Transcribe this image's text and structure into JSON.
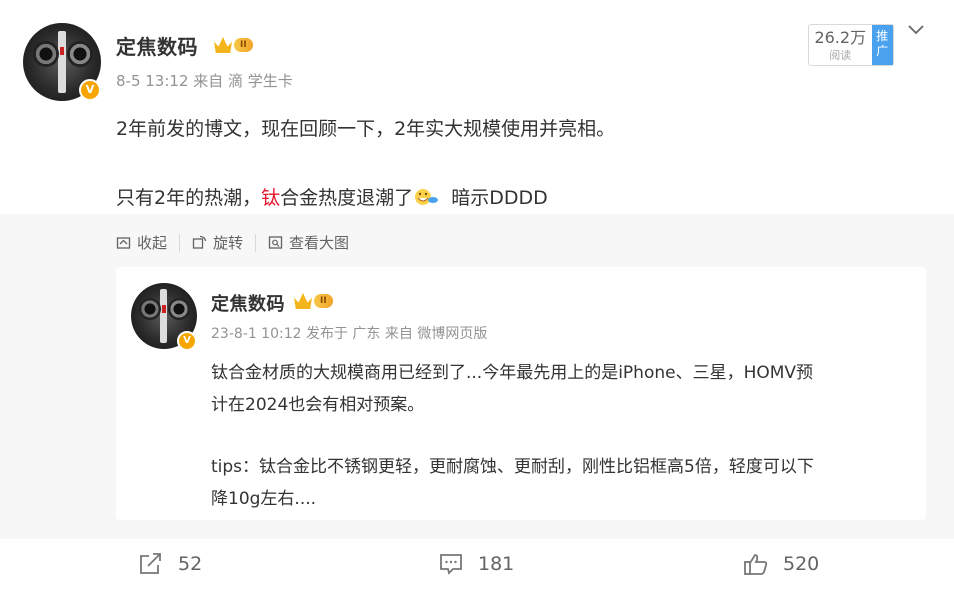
{
  "post": {
    "author": "定焦数码",
    "meta": "8-5 13:12 来自 滴 学生卡",
    "line1": "2年前发的博文，现在回顾一下，2年实大规模使用并亮相。",
    "line2_a": "只有2年的热潮，",
    "line2_red": "钛",
    "line2_b": "合金热度退潮了",
    "line2_c": "暗示DDDD",
    "read_count": "26.2万",
    "read_label": "阅读",
    "promote_top": "推",
    "promote_bottom": "广",
    "badge": "V",
    "crown_level": "II"
  },
  "actions": {
    "collapse": "收起",
    "rotate": "旋转",
    "view_large": "查看大图"
  },
  "repost": {
    "author": "定焦数码",
    "meta": "23-8-1 10:12 发布于 广东 来自 微博网页版",
    "line1": "钛合金材质的大规模商用已经到了...今年最先用上的是iPhone、三星，HOMV预",
    "line2": "计在2024也会有相对预案。",
    "line3": "tips：钛合金比不锈钢更轻，更耐腐蚀、更耐刮，刚性比铝框高5倍，轻度可以下",
    "line4": "降10g左右...."
  },
  "footer": {
    "share_count": "52",
    "comment_count": "181",
    "like_count": "520"
  },
  "colors": {
    "accent_red": "#e6162d",
    "badge_orange": "#f7a600",
    "promote_blue": "#4aa2ef"
  }
}
